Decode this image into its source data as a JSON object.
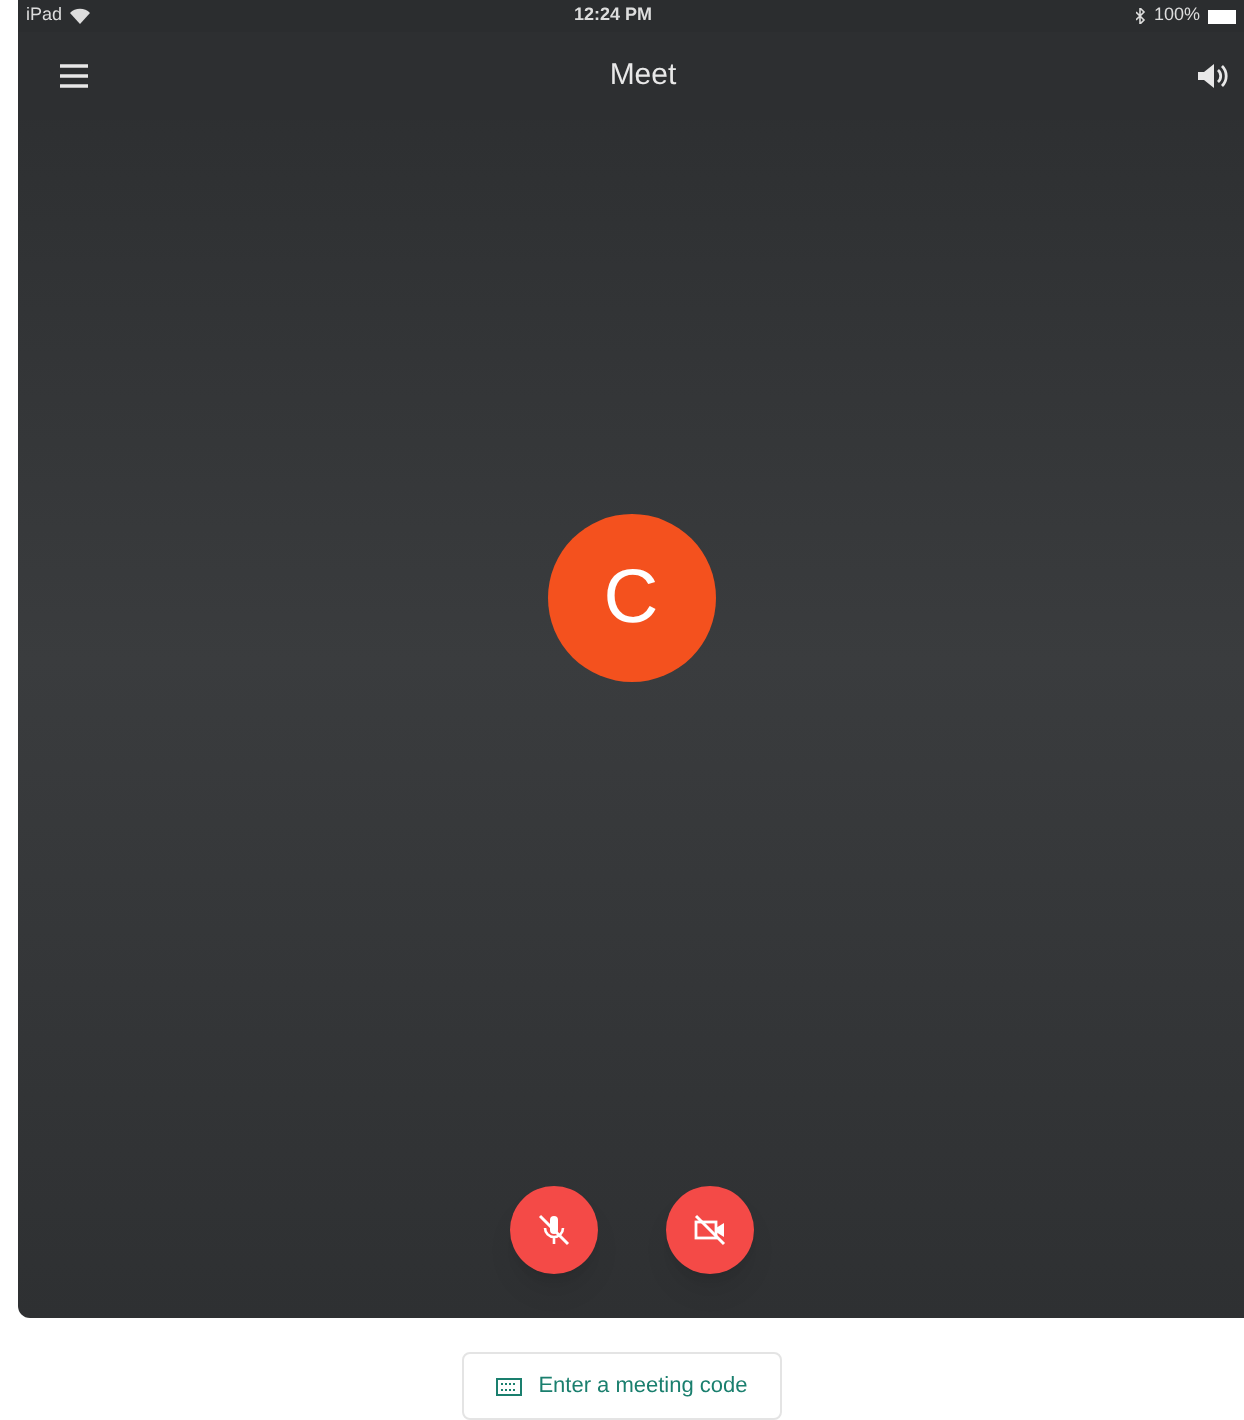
{
  "status_bar": {
    "device": "iPad",
    "time": "12:24 PM",
    "battery": "100%"
  },
  "header": {
    "title": "Meet"
  },
  "avatar": {
    "initial": "C",
    "color": "#f4511e"
  },
  "controls": {
    "mic_muted": true,
    "camera_off": true
  },
  "join": {
    "label": "Enter a meeting code"
  }
}
